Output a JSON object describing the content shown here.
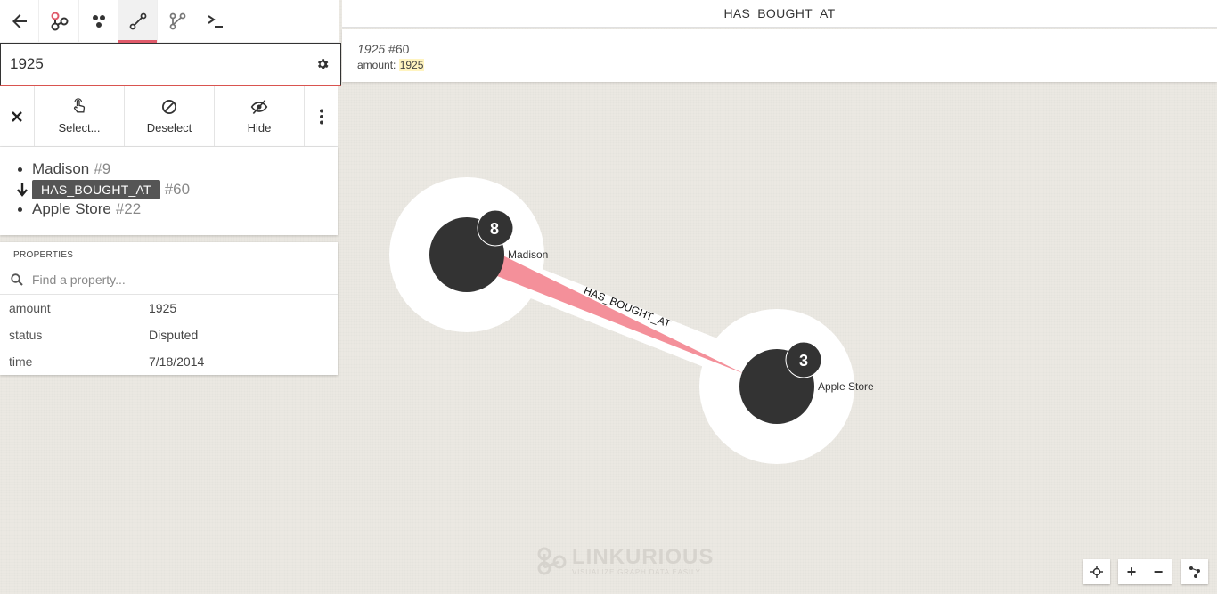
{
  "toolbar": {
    "items": [
      "back-arrow-icon",
      "graph-icon",
      "nodes-icon",
      "edge-icon",
      "path-icon",
      "terminal-icon"
    ],
    "active": "edge-icon"
  },
  "search": {
    "value": "1925"
  },
  "actions": {
    "select_label": "Select...",
    "deselect_label": "Deselect",
    "hide_label": "Hide"
  },
  "selection": {
    "source": {
      "name": "Madison",
      "id": "#9"
    },
    "edge": {
      "type": "HAS_BOUGHT_AT",
      "id": "#60"
    },
    "target": {
      "name": "Apple Store",
      "id": "#22"
    }
  },
  "properties": {
    "title": "PROPERTIES",
    "search_placeholder": "Find a property...",
    "rows": [
      {
        "key": "amount",
        "value": "1925"
      },
      {
        "key": "status",
        "value": "Disputed"
      },
      {
        "key": "time",
        "value": "7/18/2014"
      }
    ]
  },
  "header": {
    "title": "HAS_BOUGHT_AT"
  },
  "tooltip": {
    "title_value": "1925",
    "title_id": "#60",
    "key": "amount:",
    "value": "1925"
  },
  "graph": {
    "node_a": {
      "label": "Madison",
      "count": "8"
    },
    "node_b": {
      "label": "Apple Store",
      "count": "3"
    },
    "edge_label": "HAS_BOUGHT_AT",
    "edge_color": "#f4909a",
    "node_color": "#333333"
  },
  "watermark": {
    "main": "LINKURIOUS",
    "sub": "VISUALIZE GRAPH DATA EASILY"
  },
  "controls": {
    "zoom_in": "+",
    "zoom_out": "−"
  }
}
